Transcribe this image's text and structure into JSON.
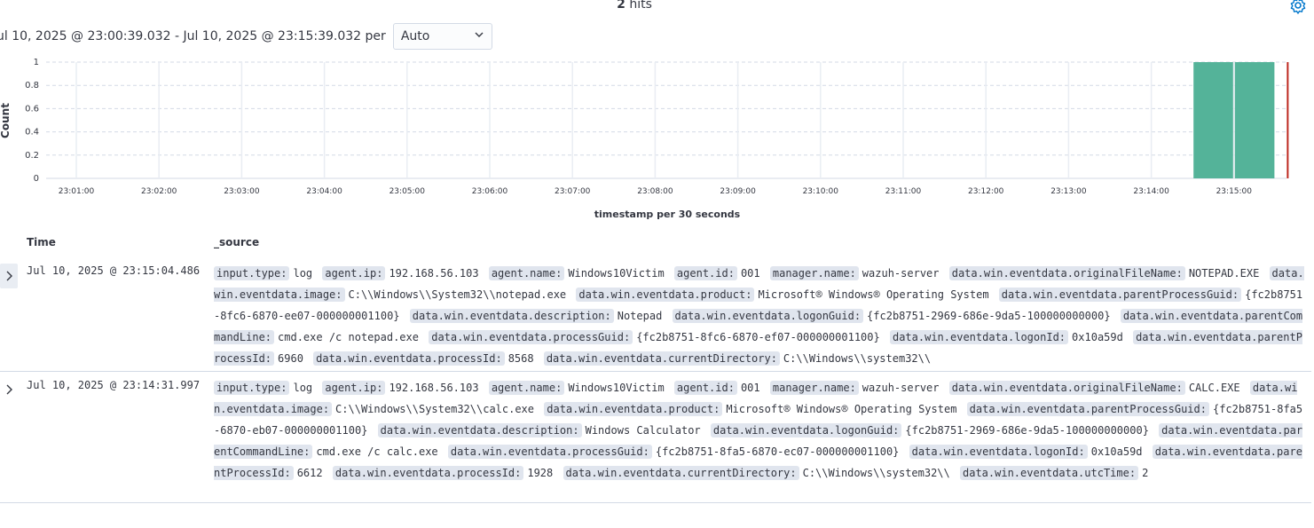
{
  "header": {
    "hits_count": "2",
    "hits_label": "hits",
    "time_range": "ul 10, 2025 @ 23:00:39.032 - Jul 10, 2025 @ 23:15:39.032 per",
    "interval_value": "Auto"
  },
  "chart_data": {
    "type": "bar",
    "ylabel": "Count",
    "xlabel": "timestamp per 30 seconds",
    "ylim": [
      0,
      1
    ],
    "y_ticks": [
      "1",
      "0.8",
      "0.6",
      "0.4",
      "0.2",
      "0"
    ],
    "x_ticks": [
      "23:01:00",
      "23:02:00",
      "23:03:00",
      "23:04:00",
      "23:05:00",
      "23:06:00",
      "23:07:00",
      "23:08:00",
      "23:09:00",
      "23:10:00",
      "23:11:00",
      "23:12:00",
      "23:13:00",
      "23:14:00",
      "23:15:00"
    ],
    "bars": [
      {
        "x": "23:14:30",
        "value": 1
      },
      {
        "x": "23:15:00",
        "value": 1
      }
    ],
    "bar_color": "#54b399",
    "current_time_marker": "23:15:39",
    "marker_color": "#bd271e",
    "grid": true
  },
  "table": {
    "col_time": "Time",
    "col_source": "_source",
    "rows": [
      {
        "time": "Jul 10, 2025 @ 23:15:04.486",
        "fields": [
          [
            "input.type:",
            "log"
          ],
          [
            "agent.ip:",
            "192.168.56.103"
          ],
          [
            "agent.name:",
            "Windows10Victim"
          ],
          [
            "agent.id:",
            "001"
          ],
          [
            "manager.name:",
            "wazuh-server"
          ],
          [
            "data.win.eventdata.originalFileName:",
            "NOTEPAD.EXE"
          ],
          [
            "data.win.eventdata.image:",
            "C:\\\\Windows\\\\System32\\\\notepad.exe"
          ],
          [
            "data.win.eventdata.product:",
            "Microsoft® Windows® Operating System"
          ],
          [
            "data.win.eventdata.parentProcessGuid:",
            "{fc2b8751-8fc6-6870-ee07-000000001100}"
          ],
          [
            "data.win.eventdata.description:",
            "Notepad"
          ],
          [
            "data.win.eventdata.logonGuid:",
            "{fc2b8751-2969-686e-9da5-100000000000}"
          ],
          [
            "data.win.eventdata.parentCommandLine:",
            "cmd.exe /c notepad.exe"
          ],
          [
            "data.win.eventdata.processGuid:",
            "{fc2b8751-8fc6-6870-ef07-000000001100}"
          ],
          [
            "data.win.eventdata.logonId:",
            "0x10a59d"
          ],
          [
            "data.win.eventdata.parentProcessId:",
            "6960"
          ],
          [
            "data.win.eventdata.processId:",
            "8568"
          ],
          [
            "data.win.eventdata.currentDirectory:",
            "C:\\\\Windows\\\\system32\\\\"
          ]
        ]
      },
      {
        "time": "Jul 10, 2025 @ 23:14:31.997",
        "fields": [
          [
            "input.type:",
            "log"
          ],
          [
            "agent.ip:",
            "192.168.56.103"
          ],
          [
            "agent.name:",
            "Windows10Victim"
          ],
          [
            "agent.id:",
            "001"
          ],
          [
            "manager.name:",
            "wazuh-server"
          ],
          [
            "data.win.eventdata.originalFileName:",
            "CALC.EXE"
          ],
          [
            "data.win.eventdata.image:",
            "C:\\\\Windows\\\\System32\\\\calc.exe"
          ],
          [
            "data.win.eventdata.product:",
            "Microsoft® Windows® Operating System"
          ],
          [
            "data.win.eventdata.parentProcessGuid:",
            "{fc2b8751-8fa5-6870-eb07-000000001100}"
          ],
          [
            "data.win.eventdata.description:",
            "Windows Calculator"
          ],
          [
            "data.win.eventdata.logonGuid:",
            "{fc2b8751-2969-686e-9da5-100000000000}"
          ],
          [
            "data.win.eventdata.parentCommandLine:",
            "cmd.exe /c calc.exe"
          ],
          [
            "data.win.eventdata.processGuid:",
            "{fc2b8751-8fa5-6870-ec07-000000001100}"
          ],
          [
            "data.win.eventdata.logonId:",
            "0x10a59d"
          ],
          [
            "data.win.eventdata.parentProcessId:",
            "6612"
          ],
          [
            "data.win.eventdata.processId:",
            "1928"
          ],
          [
            "data.win.eventdata.currentDirectory:",
            "C:\\\\Windows\\\\system32\\\\"
          ],
          [
            "data.win.eventdata.utcTime:",
            "2"
          ]
        ]
      }
    ]
  },
  "icons": {
    "settings": "gear-icon",
    "select_arrow": "chevron-down-icon",
    "expand": "chevron-right-icon"
  }
}
